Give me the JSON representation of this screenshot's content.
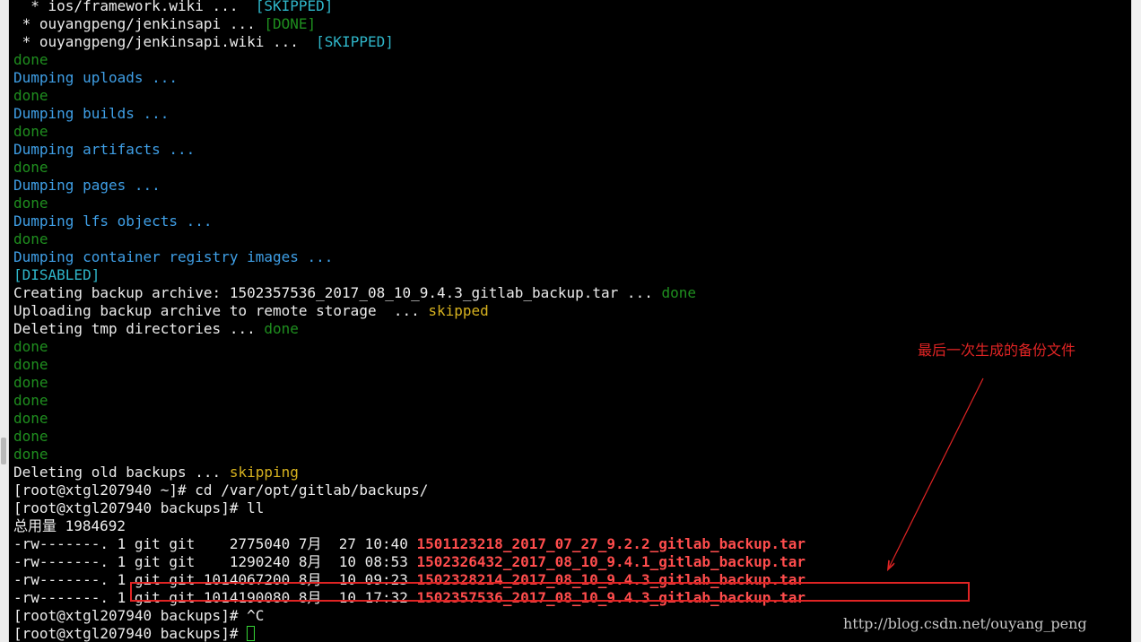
{
  "terminal": {
    "lines": [
      [
        {
          "t": "  * ios/framework.wiki ...  ",
          "c": "white"
        },
        {
          "t": "[SKIPPED]",
          "c": "cyan"
        }
      ],
      [
        {
          "t": " * ouyangpeng/jenkinsapi ... ",
          "c": "white"
        },
        {
          "t": "[DONE]",
          "c": "green"
        }
      ],
      [
        {
          "t": " * ouyangpeng/jenkinsapi.wiki ...  ",
          "c": "white"
        },
        {
          "t": "[SKIPPED]",
          "c": "cyan"
        }
      ],
      [
        {
          "t": "done",
          "c": "green"
        }
      ],
      [
        {
          "t": "Dumping uploads ...",
          "c": "blue"
        }
      ],
      [
        {
          "t": "done",
          "c": "green"
        }
      ],
      [
        {
          "t": "Dumping builds ...",
          "c": "blue"
        }
      ],
      [
        {
          "t": "done",
          "c": "green"
        }
      ],
      [
        {
          "t": "Dumping artifacts ...",
          "c": "blue"
        }
      ],
      [
        {
          "t": "done",
          "c": "green"
        }
      ],
      [
        {
          "t": "Dumping pages ...",
          "c": "blue"
        }
      ],
      [
        {
          "t": "done",
          "c": "green"
        }
      ],
      [
        {
          "t": "Dumping lfs objects ...",
          "c": "blue"
        }
      ],
      [
        {
          "t": "done",
          "c": "green"
        }
      ],
      [
        {
          "t": "Dumping container registry images ...",
          "c": "blue"
        }
      ],
      [
        {
          "t": "[DISABLED]",
          "c": "cyan"
        }
      ],
      [
        {
          "t": "Creating backup archive: 1502357536_2017_08_10_9.4.3_gitlab_backup.tar ... ",
          "c": "white"
        },
        {
          "t": "done",
          "c": "green"
        }
      ],
      [
        {
          "t": "Uploading backup archive to remote storage  ... ",
          "c": "white"
        },
        {
          "t": "skipped",
          "c": "yellow"
        }
      ],
      [
        {
          "t": "Deleting tmp directories ... ",
          "c": "white"
        },
        {
          "t": "done",
          "c": "green"
        }
      ],
      [
        {
          "t": "done",
          "c": "green"
        }
      ],
      [
        {
          "t": "done",
          "c": "green"
        }
      ],
      [
        {
          "t": "done",
          "c": "green"
        }
      ],
      [
        {
          "t": "done",
          "c": "green"
        }
      ],
      [
        {
          "t": "done",
          "c": "green"
        }
      ],
      [
        {
          "t": "done",
          "c": "green"
        }
      ],
      [
        {
          "t": "done",
          "c": "green"
        }
      ],
      [
        {
          "t": "Deleting old backups ... ",
          "c": "white"
        },
        {
          "t": "skipping",
          "c": "yellow"
        }
      ],
      [
        {
          "t": "[root@xtgl207940 ~]# cd /var/opt/gitlab/backups/",
          "c": "white"
        }
      ],
      [
        {
          "t": "[root@xtgl207940 backups]# ll",
          "c": "white"
        }
      ],
      [
        {
          "t": "总用量 1984692",
          "c": "white"
        }
      ],
      [
        {
          "t": "-rw-------. 1 git git    2775040 7月  27 10:40 ",
          "c": "white"
        },
        {
          "t": "1501123218_2017_07_27_9.2.2_gitlab_backup.tar",
          "c": "red"
        }
      ],
      [
        {
          "t": "-rw-------. 1 git git    1290240 8月  10 08:53 ",
          "c": "white"
        },
        {
          "t": "1502326432_2017_08_10_9.4.1_gitlab_backup.tar",
          "c": "red"
        }
      ],
      [
        {
          "t": "-rw-------. 1 git git 1014067200 8月  10 09:23 ",
          "c": "white"
        },
        {
          "t": "1502328214_2017_08_10_9.4.3_gitlab_backup.tar",
          "c": "red"
        }
      ],
      [
        {
          "t": "-rw-------. 1 git git 1014190080 8月  10 17:32 ",
          "c": "white"
        },
        {
          "t": "1502357536_2017_08_10_9.4.3_gitlab_backup.tar",
          "c": "red"
        }
      ],
      [
        {
          "t": "[root@xtgl207940 backups]# ^C",
          "c": "white"
        }
      ],
      [
        {
          "t": "[root@xtgl207940 backups]# ",
          "c": "white"
        },
        {
          "t": "",
          "c": "cursor"
        }
      ]
    ]
  },
  "annotation": {
    "text": "最后一次生成的备份文件",
    "color": "#e02424"
  },
  "watermark": "http://blog.csdn.net/ouyang_peng",
  "colors": {
    "background": "#000000",
    "white": "#ececec",
    "blue": "#3f9fe6",
    "green": "#1f8f1f",
    "cyan": "#2fb6c9",
    "yellow": "#d7b21f",
    "red": "#ff4d4d"
  }
}
